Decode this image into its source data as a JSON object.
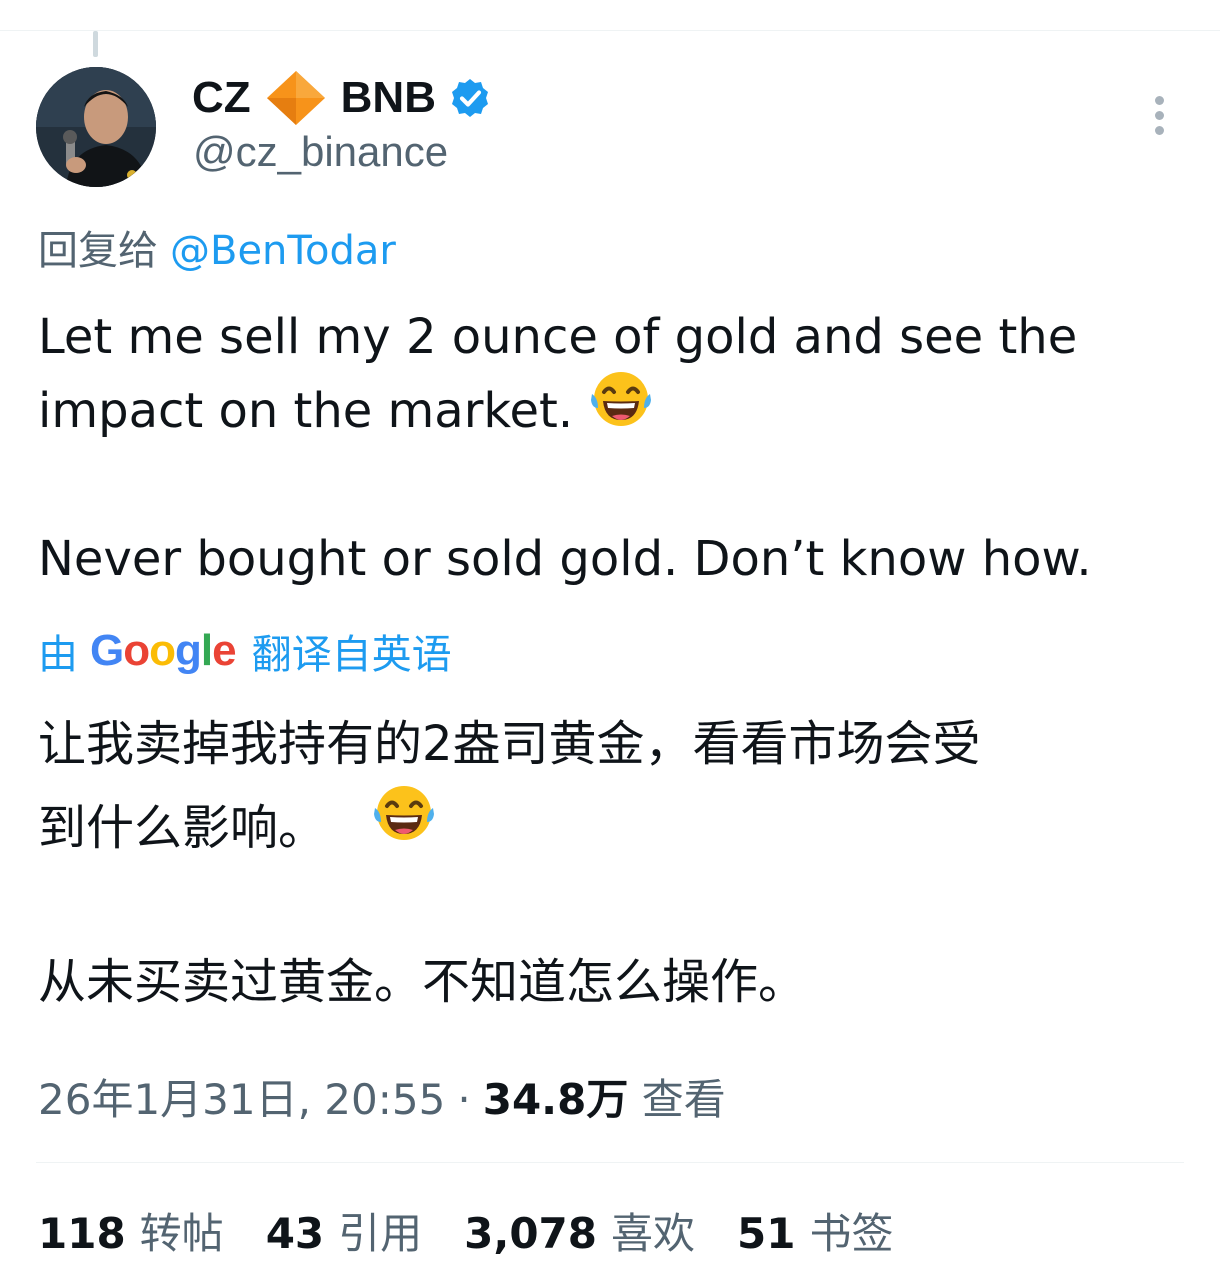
{
  "tweet": {
    "author": {
      "name_first": "CZ",
      "name_second": "BNB",
      "handle": "@cz_binance"
    },
    "reply_prefix": "回复给",
    "reply_mention": "@BenTodar",
    "text_lines": [
      "Let me sell my 2 ounce of gold and see the",
      "impact on the market.",
      "Never bought or sold gold. Don’t know how."
    ],
    "translation": {
      "prefix": "由",
      "brand": "Google",
      "suffix": "翻译自英语",
      "lines": [
        "让我卖掉我持有的2盎司黄金，看看市场会受",
        "到什么影响。",
        "从未买卖过黄金。不知道怎么操作。"
      ]
    },
    "meta": {
      "timestamp": "26年1月31日, 20:55",
      "separator": "·",
      "views_count": "34.8万",
      "views_label": "查看"
    },
    "stats": [
      {
        "count": "118",
        "label": "转帖"
      },
      {
        "count": "43",
        "label": "引用"
      },
      {
        "count": "3,078",
        "label": "喜欢"
      },
      {
        "count": "51",
        "label": "书签"
      }
    ],
    "emoji_name": "face-with-tears-of-joy-icon",
    "colors": {
      "accent": "#1d9bf0",
      "secondary_text": "#536471",
      "primary_text": "#0f1419",
      "diamond": "#f7931a"
    }
  }
}
